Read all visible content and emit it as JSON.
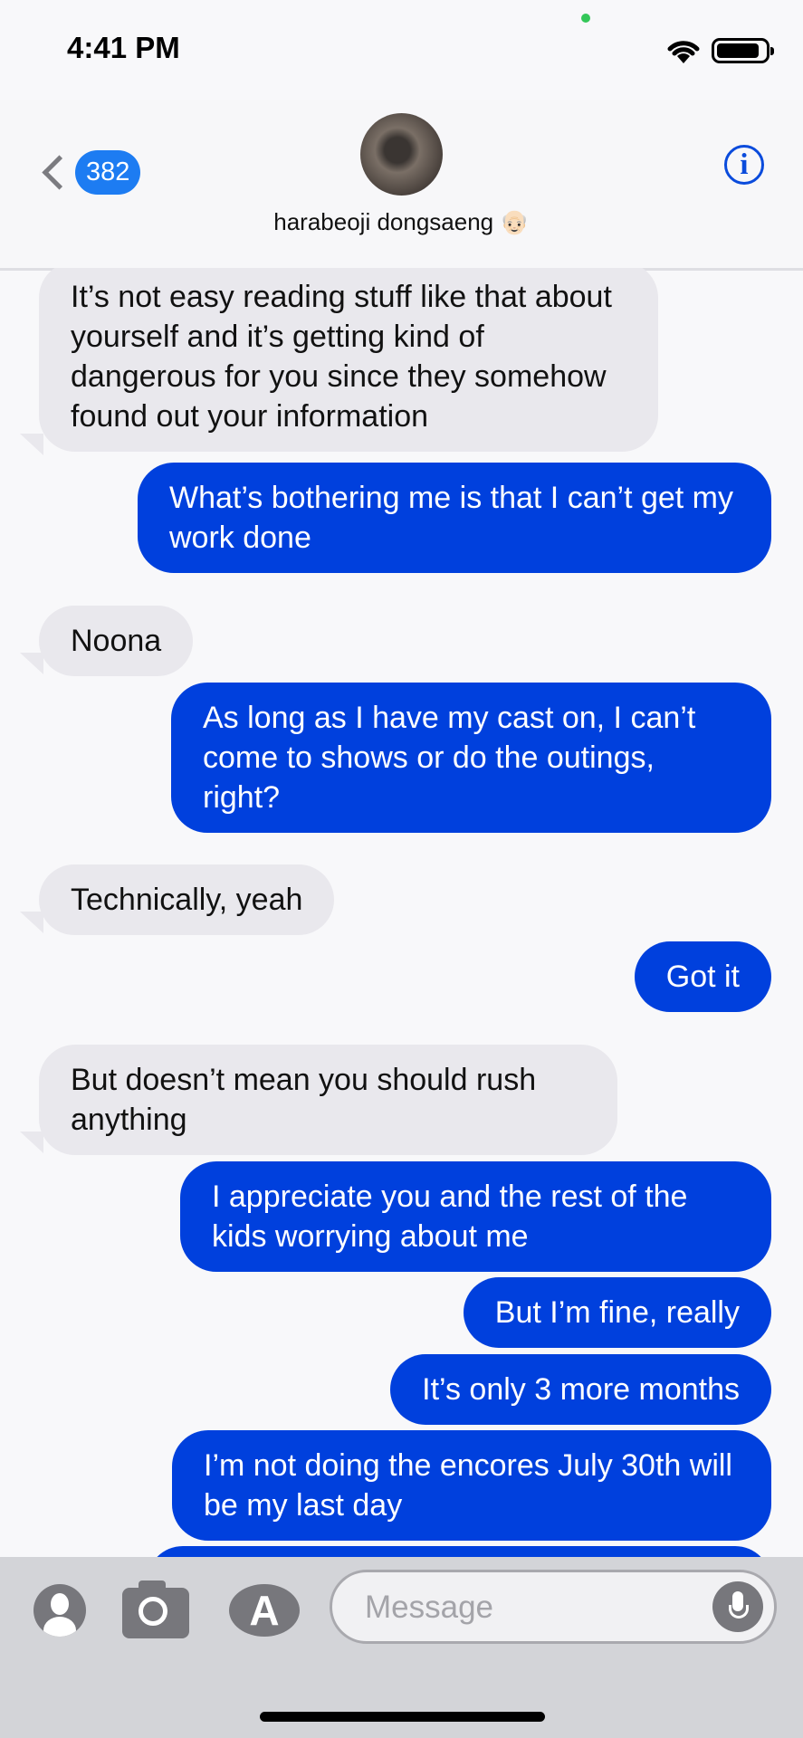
{
  "status": {
    "time": "4:41 PM"
  },
  "header": {
    "back_count": "382",
    "contact_name": "harabeoji dongsaeng 👴🏻",
    "info_glyph": "i"
  },
  "messages": [
    {
      "dir": "in",
      "text": "It’s not easy reading stuff like that about yourself and it’s getting kind of dangerous for you since they somehow found out your information"
    },
    {
      "dir": "out",
      "text": "What’s bothering me is that I can’t get my work done"
    },
    {
      "dir": "in",
      "text": "Noona"
    },
    {
      "dir": "out",
      "text": "As long as I have my cast on, I can’t come to shows or do the outings, right?"
    },
    {
      "dir": "in",
      "text": "Technically, yeah"
    },
    {
      "dir": "out",
      "text": "Got it"
    },
    {
      "dir": "in",
      "text": "But doesn’t mean you should rush anything"
    },
    {
      "dir": "out",
      "text": "I appreciate you and the rest of the kids worrying about me"
    },
    {
      "dir": "out",
      "text": "But I’m fine, really"
    },
    {
      "dir": "out",
      "text": "It’s only 3 more months"
    },
    {
      "dir": "out",
      "text": "I’m not doing the encores July 30th will be my last day"
    }
  ],
  "composer": {
    "placeholder": "Message"
  },
  "colors": {
    "outgoing": "#0040dd",
    "incoming": "#e9e8ed",
    "badge": "#1d7cf2"
  }
}
